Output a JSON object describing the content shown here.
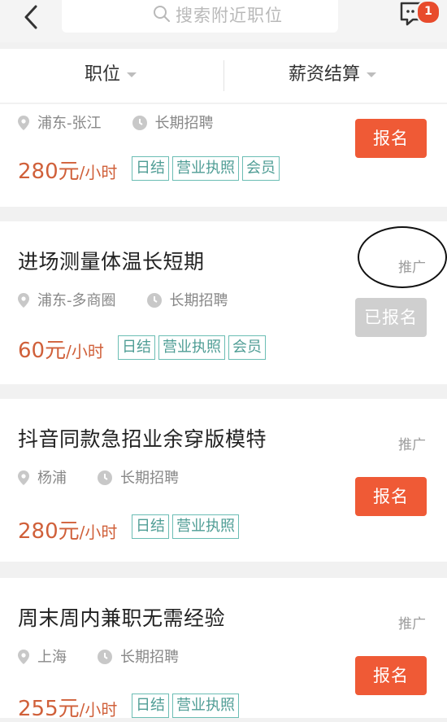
{
  "topbar": {
    "search_placeholder": "搜索附近职位",
    "message_badge": "1"
  },
  "filters": [
    {
      "label": "职位"
    },
    {
      "label": "薪资结算"
    }
  ],
  "jobs": [
    {
      "title": "",
      "location": "浦东-张江",
      "term": "长期招聘",
      "pay_amount": "280元",
      "pay_unit": "/小时",
      "tags": [
        "日结",
        "营业执照",
        "会员"
      ],
      "button_label": "报名",
      "button_state": "enabled",
      "promo": ""
    },
    {
      "title": "进场测量体温长短期",
      "location": "浦东-多商圈",
      "term": "长期招聘",
      "pay_amount": "60元",
      "pay_unit": "/小时",
      "tags": [
        "日结",
        "营业执照",
        "会员"
      ],
      "button_label": "已报名",
      "button_state": "disabled",
      "promo": "推广"
    },
    {
      "title": "抖音同款急招业余穿版模特",
      "location": "杨浦",
      "term": "长期招聘",
      "pay_amount": "280元",
      "pay_unit": "/小时",
      "tags": [
        "日结",
        "营业执照"
      ],
      "button_label": "报名",
      "button_state": "enabled",
      "promo": "推广"
    },
    {
      "title": "周末周内兼职无需经验",
      "location": "上海",
      "term": "长期招聘",
      "pay_amount": "255元",
      "pay_unit": "/小时",
      "tags": [
        "日结",
        "营业执照"
      ],
      "button_label": "报名",
      "button_state": "enabled",
      "promo": "推广"
    }
  ],
  "colors": {
    "accent_orange": "#ef5a36",
    "pay_text": "#d0603a",
    "tag_teal": "#4f9d95",
    "disabled_gray": "#cfcfcf"
  },
  "icons": [
    "back-chevron-icon",
    "search-icon",
    "message-icon",
    "location-pin-icon",
    "clock-icon"
  ]
}
